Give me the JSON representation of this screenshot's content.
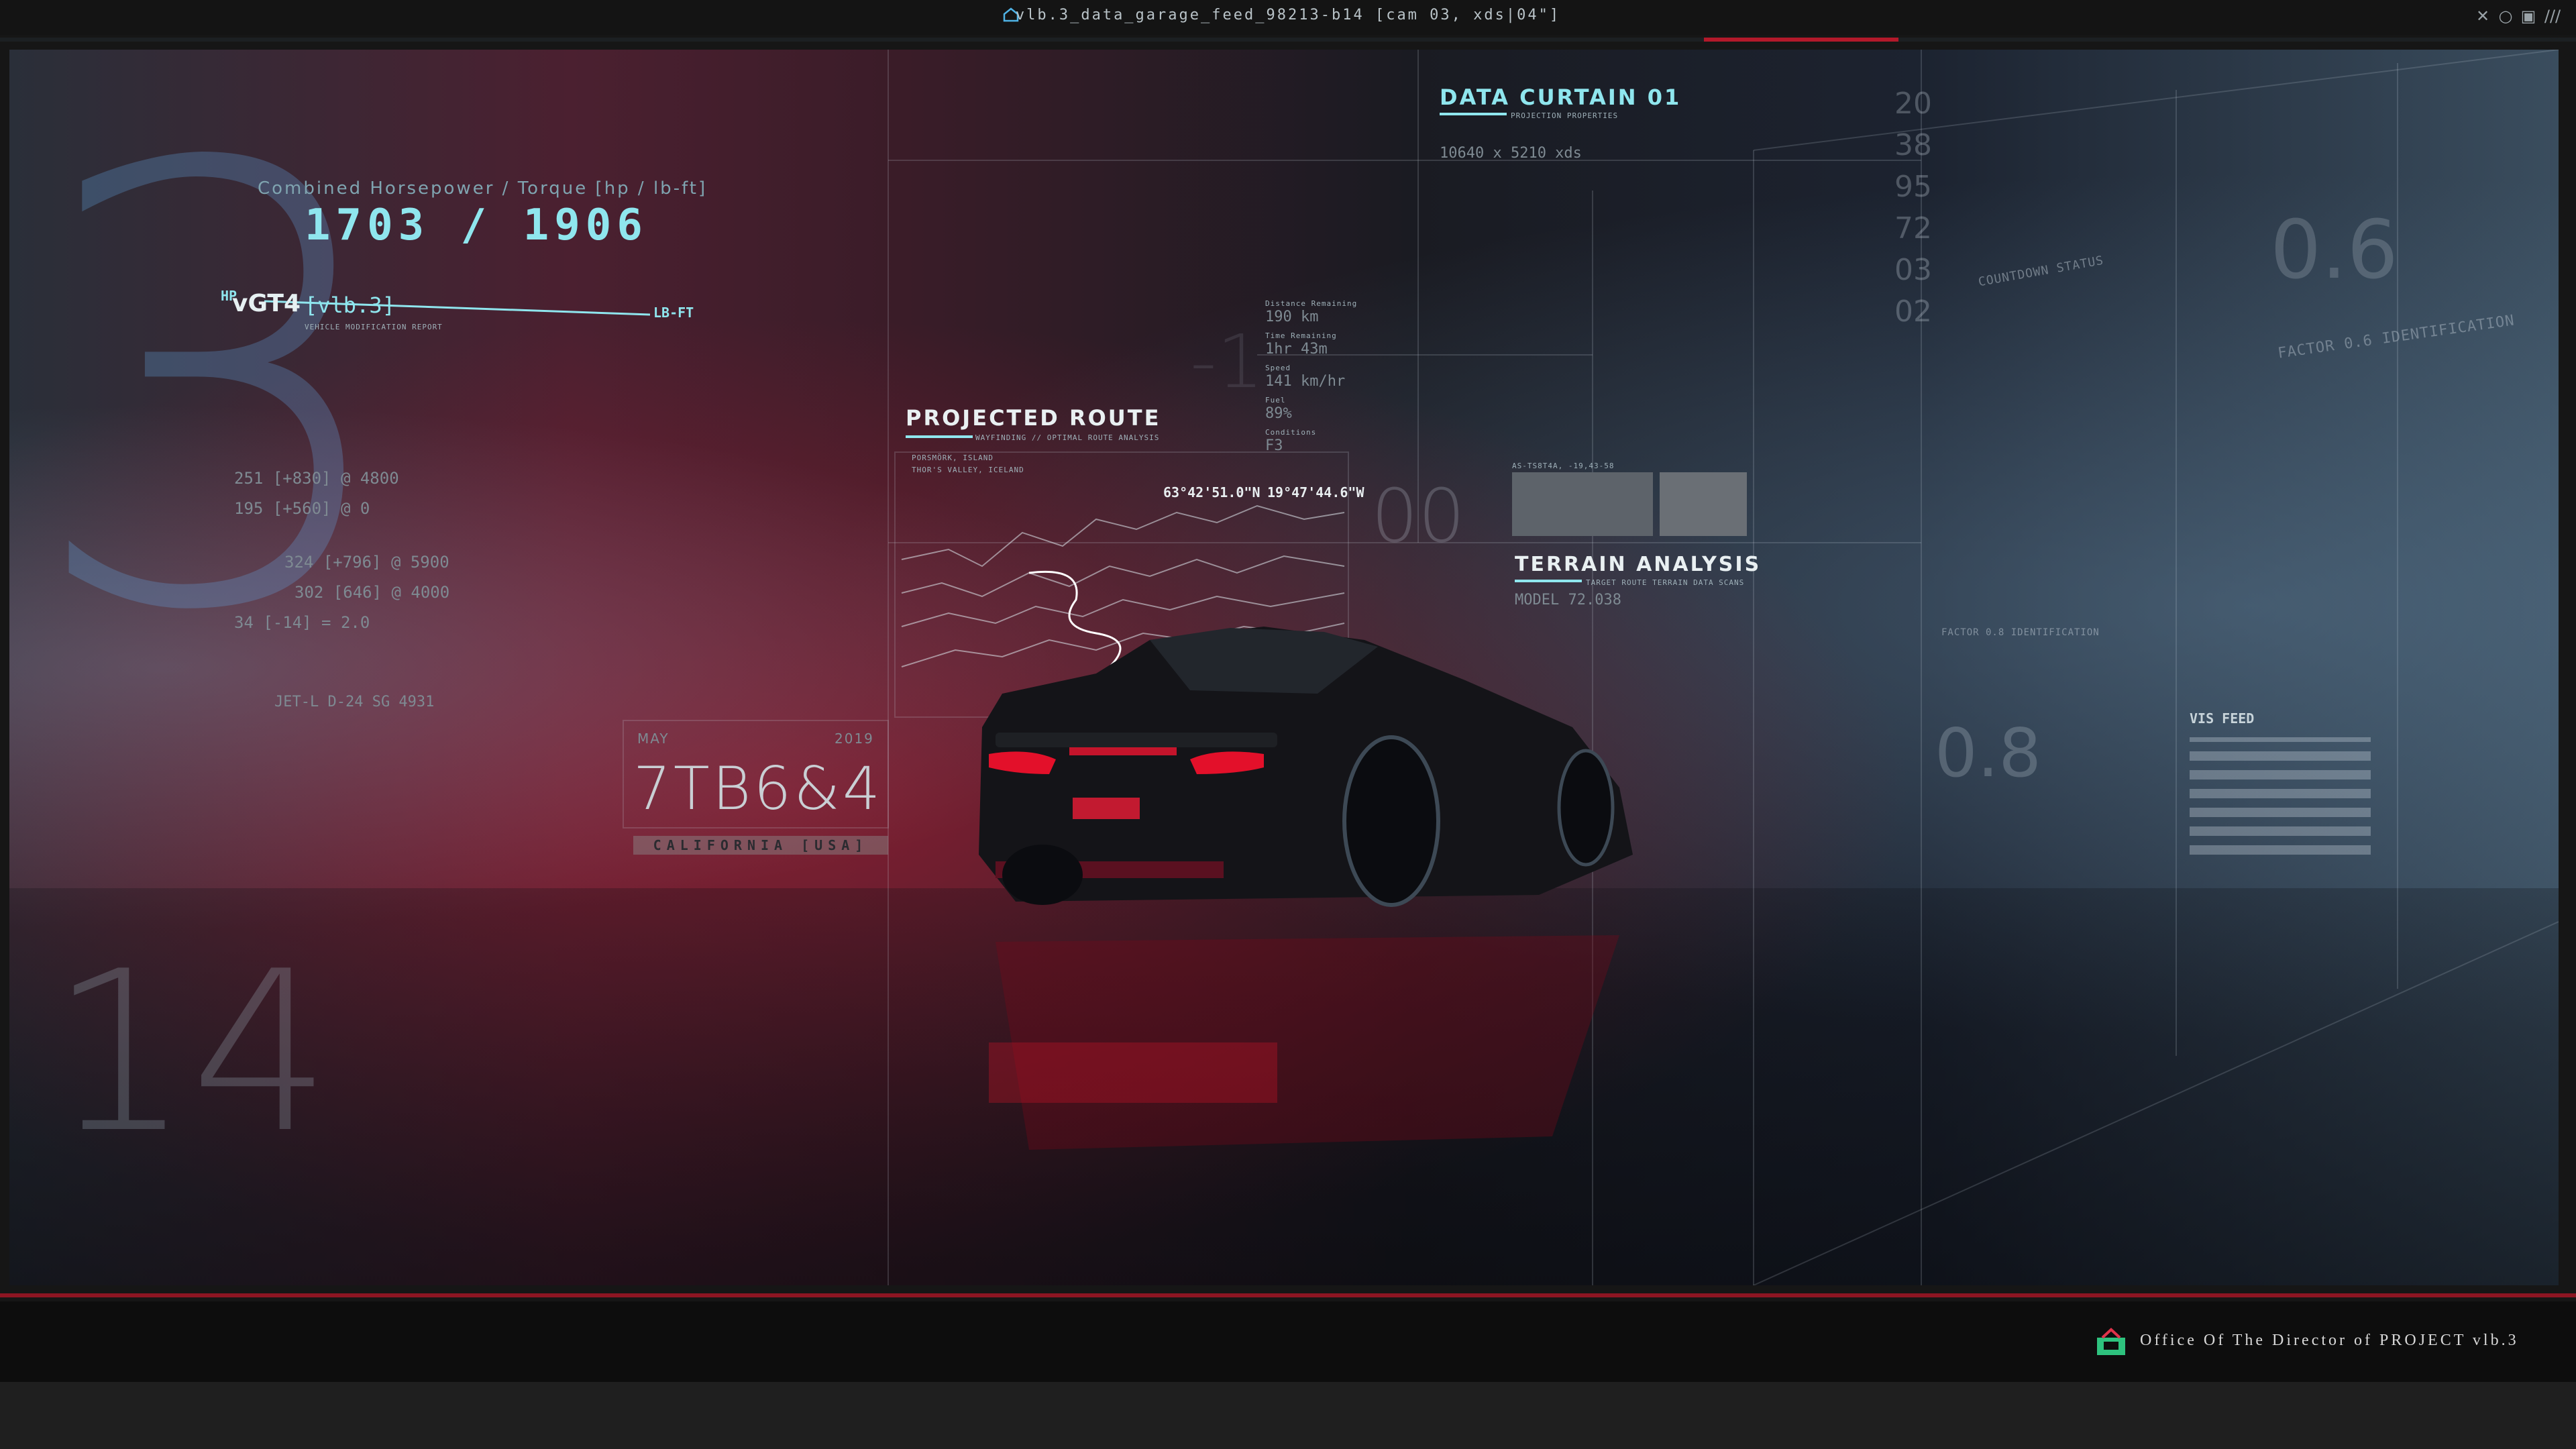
{
  "window": {
    "title": "vlb.3_data_garage_feed_98213-b14 [cam 03, xds|04\"]",
    "controls": [
      "✕",
      "○",
      "▣",
      "///"
    ]
  },
  "hud": {
    "power": {
      "caption": "Combined Horsepower / Torque [hp / lb-ft]",
      "value": "1703 / 1906",
      "left_unit": "HP",
      "right_unit": "LB-FT"
    },
    "vehicle": {
      "name": "vGT4",
      "version": "[vlb.3]",
      "subtitle": "VEHICLE MODIFICATION REPORT",
      "hp_front": "251 [+830] @ 4800",
      "torque_front": "195 [+560] @ 0",
      "hp_rear": "324 [+796] @ 5900",
      "torque_rear": "302 [646] @ 4000",
      "ratio": "34 [-14] = 2.0",
      "engine": "JET-L D-24 SG 4931"
    },
    "plate": {
      "month": "MAY",
      "year": "2019",
      "number": "7TB6&4",
      "state": "CALIFORNIA [USA]"
    },
    "route": {
      "title": "PROJECTED ROUTE",
      "subtitle": "WAYFINDING // OPTIMAL ROUTE ANALYSIS",
      "place": "PORSMÖRK, ISLAND",
      "valley": "THOR'S VALLEY, ICELAND",
      "lat": "63°42'51.0\"N",
      "lon": "19°47'44.6\"W"
    },
    "stats": {
      "distance_label": "Distance Remaining",
      "distance": "190 km",
      "time_label": "Time Remaining",
      "time": "1hr 43m",
      "speed_label": "Speed",
      "speed": "141 km/hr",
      "fuel_label": "Fuel",
      "fuel": "89%",
      "conditions_label": "Conditions",
      "conditions": "F3"
    },
    "curtain": {
      "title": "DATA CURTAIN 01",
      "subtitle": "PROJECTION PROPERTIES",
      "resolution": "10640 x 5210 xds"
    },
    "terrain": {
      "title": "TERRAIN ANALYSIS",
      "subtitle": "TARGET ROUTE TERRAIN DATA SCANS",
      "model": "MODEL 72.038",
      "scan_label": "AS-TS8T4A, -19,43-58"
    },
    "right_panels": {
      "countdown": "COUNTDOWN STATUS",
      "factor": "FACTOR 0.6 IDENTIFICATION",
      "factor_small": "FACTOR 0.8 IDENTIFICATION",
      "vis_feed": "VIS FEED",
      "value_06": "0.6",
      "value_08": "0.8",
      "numbers": [
        "20",
        "38",
        "95",
        "72",
        "03",
        "02"
      ]
    },
    "background_numbers": {
      "big_3": "3",
      "big_14": "14",
      "big_00": "00",
      "big_1": "-1"
    }
  },
  "footer": {
    "office": "Office Of The Director of PROJECT vlb.3"
  }
}
